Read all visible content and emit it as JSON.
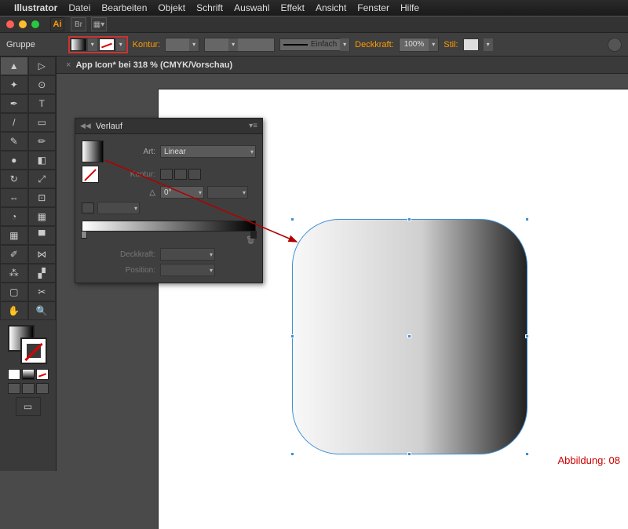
{
  "menubar": {
    "app": "Illustrator",
    "items": [
      "Datei",
      "Bearbeiten",
      "Objekt",
      "Schrift",
      "Auswahl",
      "Effekt",
      "Ansicht",
      "Fenster",
      "Hilfe"
    ]
  },
  "logo_text": "Ai",
  "control_bar": {
    "selection_label": "Gruppe",
    "kontur_label": "Kontur:",
    "stroke_style_label": "Einfach",
    "deckkraft_label": "Deckkraft:",
    "deckkraft_value": "100%",
    "stil_label": "Stil:"
  },
  "document_tab": "App Icon* bei 318 % (CMYK/Vorschau)",
  "gradient_panel": {
    "title": "Verlauf",
    "art_label": "Art:",
    "art_value": "Linear",
    "kontur_label": "Kontur:",
    "angle_value": "0°",
    "deckkraft_label": "Deckkraft:",
    "position_label": "Position:"
  },
  "caption": "Abbildung: 08",
  "tools": [
    {
      "n": "selection-tool",
      "g": "▲"
    },
    {
      "n": "direct-selection-tool",
      "g": "▷"
    },
    {
      "n": "magic-wand-tool",
      "g": "✦"
    },
    {
      "n": "lasso-tool",
      "g": "⊙"
    },
    {
      "n": "pen-tool",
      "g": "✒"
    },
    {
      "n": "type-tool",
      "g": "T"
    },
    {
      "n": "line-tool",
      "g": "/"
    },
    {
      "n": "rectangle-tool",
      "g": "▭"
    },
    {
      "n": "paintbrush-tool",
      "g": "✎"
    },
    {
      "n": "pencil-tool",
      "g": "✏"
    },
    {
      "n": "blob-brush-tool",
      "g": "●"
    },
    {
      "n": "eraser-tool",
      "g": "◧"
    },
    {
      "n": "rotate-tool",
      "g": "↻"
    },
    {
      "n": "scale-tool",
      "g": "⤢"
    },
    {
      "n": "width-tool",
      "g": "⇔"
    },
    {
      "n": "free-transform-tool",
      "g": "⊡"
    },
    {
      "n": "shape-builder-tool",
      "g": "◔"
    },
    {
      "n": "perspective-tool",
      "g": "▦"
    },
    {
      "n": "mesh-tool",
      "g": "▦"
    },
    {
      "n": "gradient-tool",
      "g": "▀"
    },
    {
      "n": "eyedropper-tool",
      "g": "✐"
    },
    {
      "n": "blend-tool",
      "g": "⋈"
    },
    {
      "n": "symbol-sprayer-tool",
      "g": "⁂"
    },
    {
      "n": "graph-tool",
      "g": "▞"
    },
    {
      "n": "artboard-tool",
      "g": "▢"
    },
    {
      "n": "slice-tool",
      "g": "✂"
    },
    {
      "n": "hand-tool",
      "g": "✋"
    },
    {
      "n": "zoom-tool",
      "g": "🔍"
    }
  ]
}
